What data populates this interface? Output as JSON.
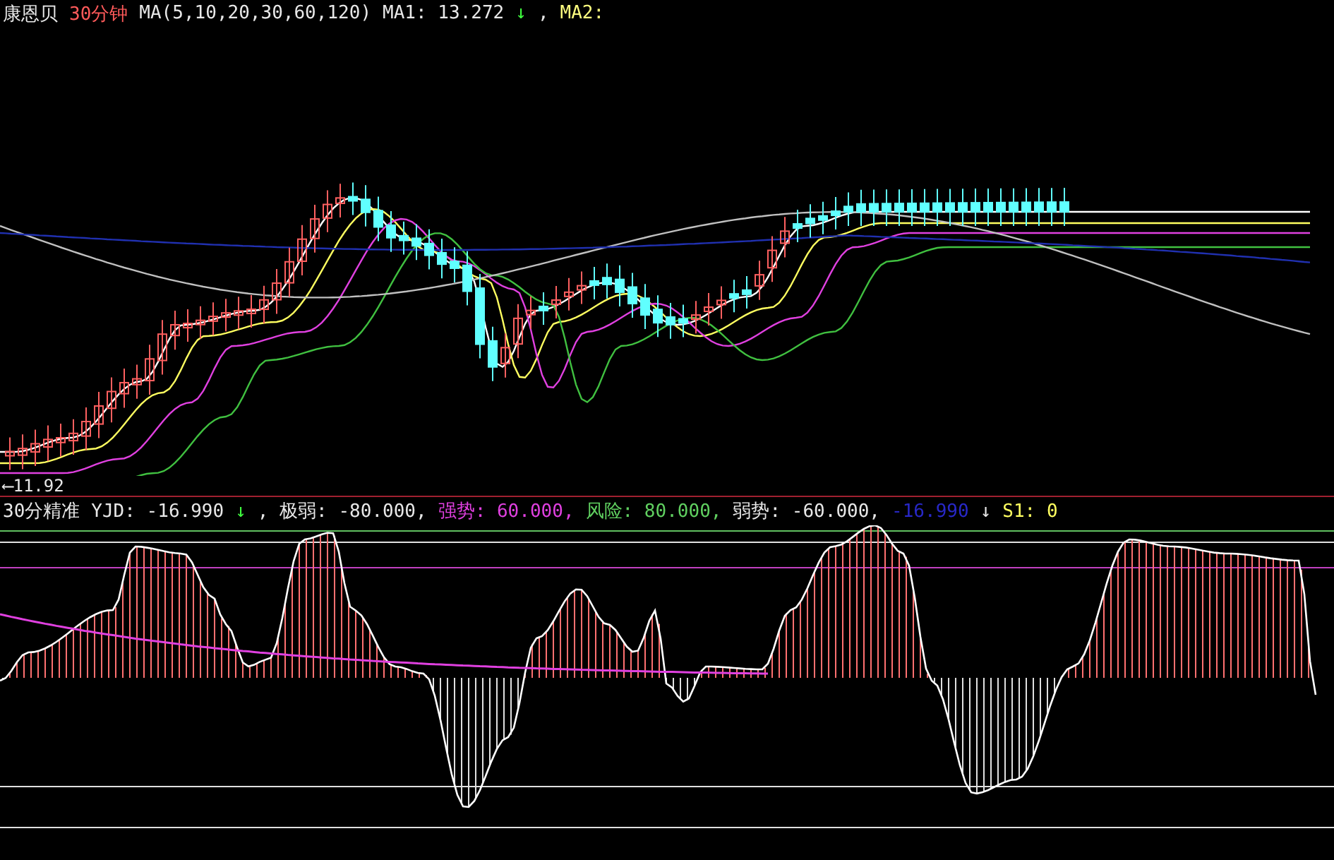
{
  "price_panel": {
    "legend": [
      {
        "text": "康恩贝",
        "color": "#e8e8e8"
      },
      {
        "text": "30分钟",
        "color": "#ff5a5a"
      },
      {
        "text": "MA(5,10,20,30,60,120)",
        "color": "#e8e8e8"
      },
      {
        "text": "MA1: 13.272",
        "color": "#e8e8e8"
      },
      {
        "text": "↓",
        "color": "#40ff40"
      },
      {
        "text": ",",
        "color": "#e8e8e8"
      },
      {
        "text": "MA2:",
        "color": "#ffff80"
      }
    ],
    "low_label": "⟵11.92"
  },
  "indicator_panel": {
    "legend": [
      {
        "text": "30分精准",
        "color": "#e8e8e8"
      },
      {
        "text": "YJD: -16.990",
        "color": "#e8e8e8"
      },
      {
        "text": "↓",
        "color": "#40ff40"
      },
      {
        "text": ", 极弱: -80.000,",
        "color": "#e8e8e8"
      },
      {
        "text": "强势: 60.000,",
        "color": "#e040e0"
      },
      {
        "text": "风险: 80.000,",
        "color": "#60d060"
      },
      {
        "text": "弱势: -60.000,",
        "color": "#e8e8e8"
      },
      {
        "text": "-16.990",
        "color": "#2828c8"
      },
      {
        "text": "↓",
        "color": "#e8e8e8"
      },
      {
        "text": "S1: 0",
        "color": "#ffff60"
      }
    ]
  }
}
